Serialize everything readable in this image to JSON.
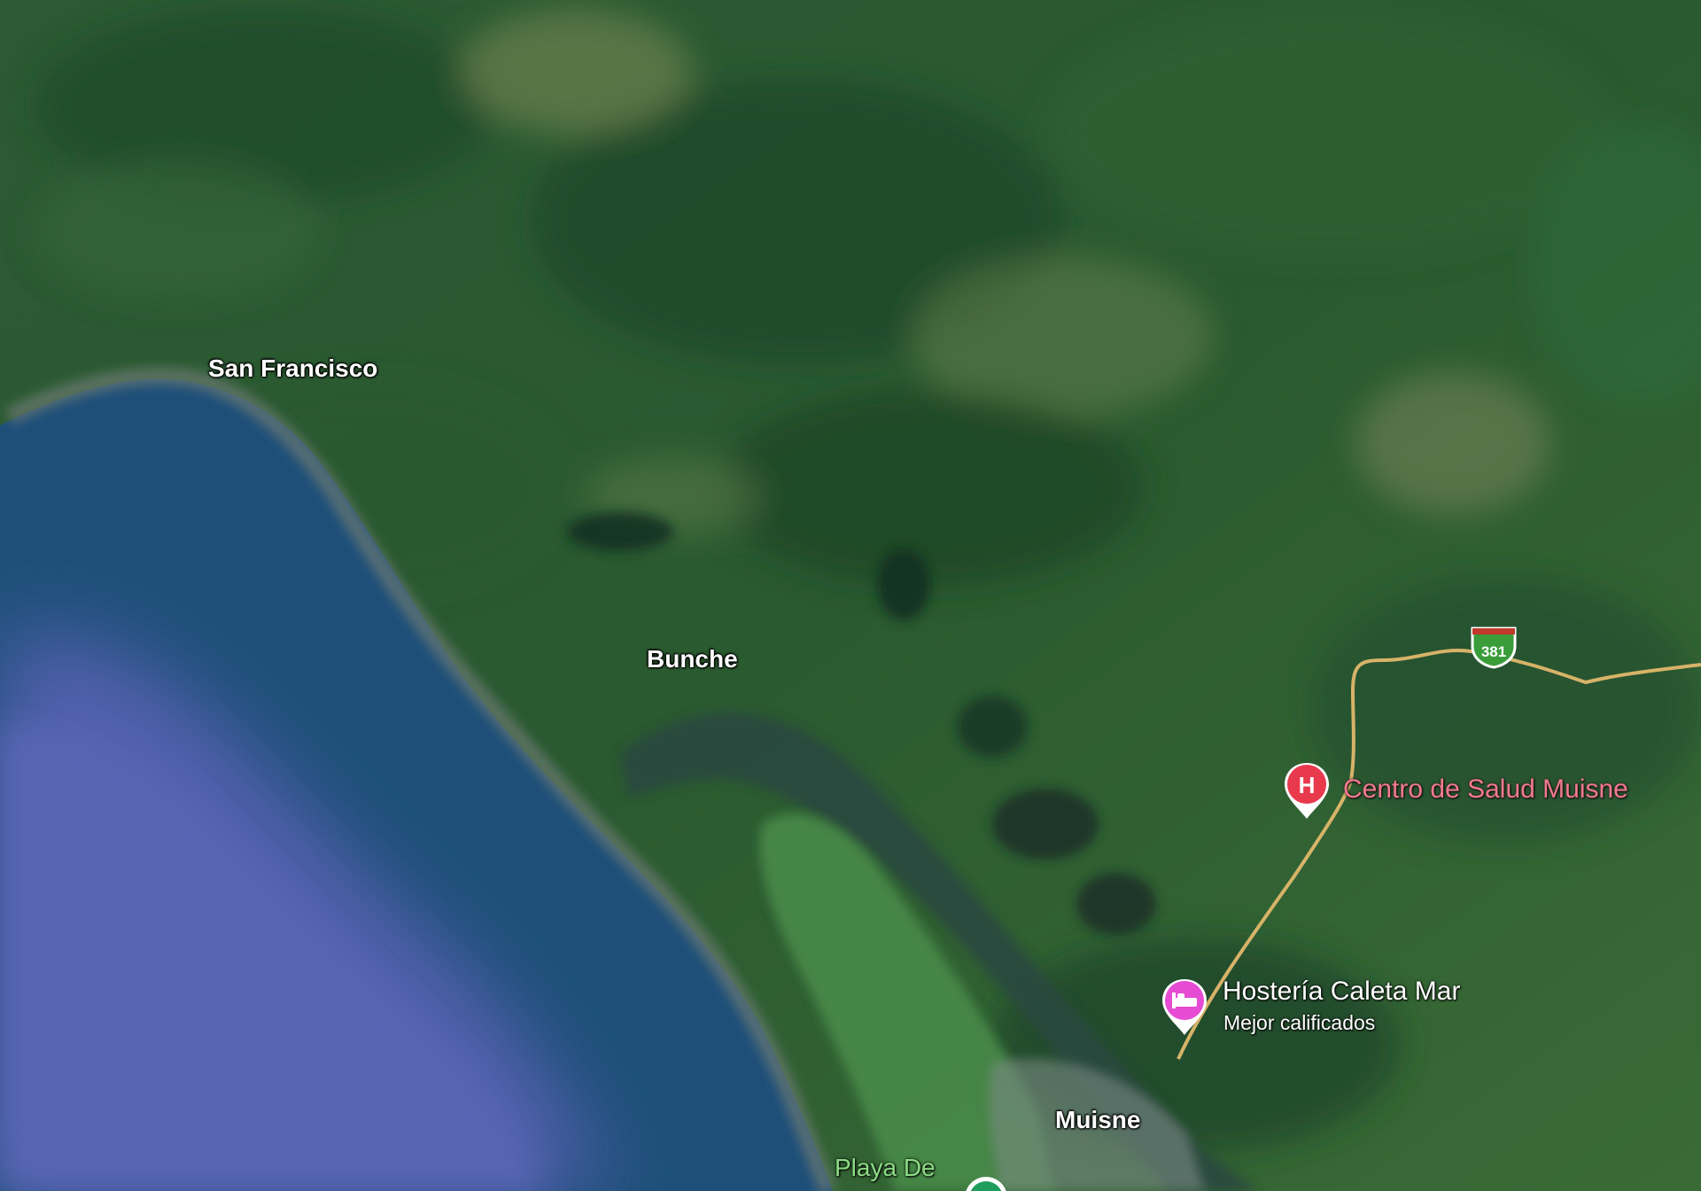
{
  "map": {
    "style": "satellite",
    "places": {
      "san_francisco": "San Francisco",
      "bunche": "Bunche",
      "muisne": "Muisne",
      "playa": "Playa De"
    },
    "pois": {
      "health_center": {
        "name": "Centro de Salud Muisne",
        "icon": "hospital-icon",
        "color": "#e8394d"
      },
      "hotel": {
        "name": "Hostería Caleta Mar",
        "subtitle": "Mejor calificados",
        "icon": "hotel-bed-icon",
        "color": "#e54bd3"
      }
    },
    "highway": {
      "number": "381",
      "color": "#3a9d3a"
    },
    "colors": {
      "ocean_deep": "#5361ae",
      "ocean_shallow": "#1e4f79",
      "land": "#2f5e34",
      "road": "#e0b86b"
    }
  }
}
